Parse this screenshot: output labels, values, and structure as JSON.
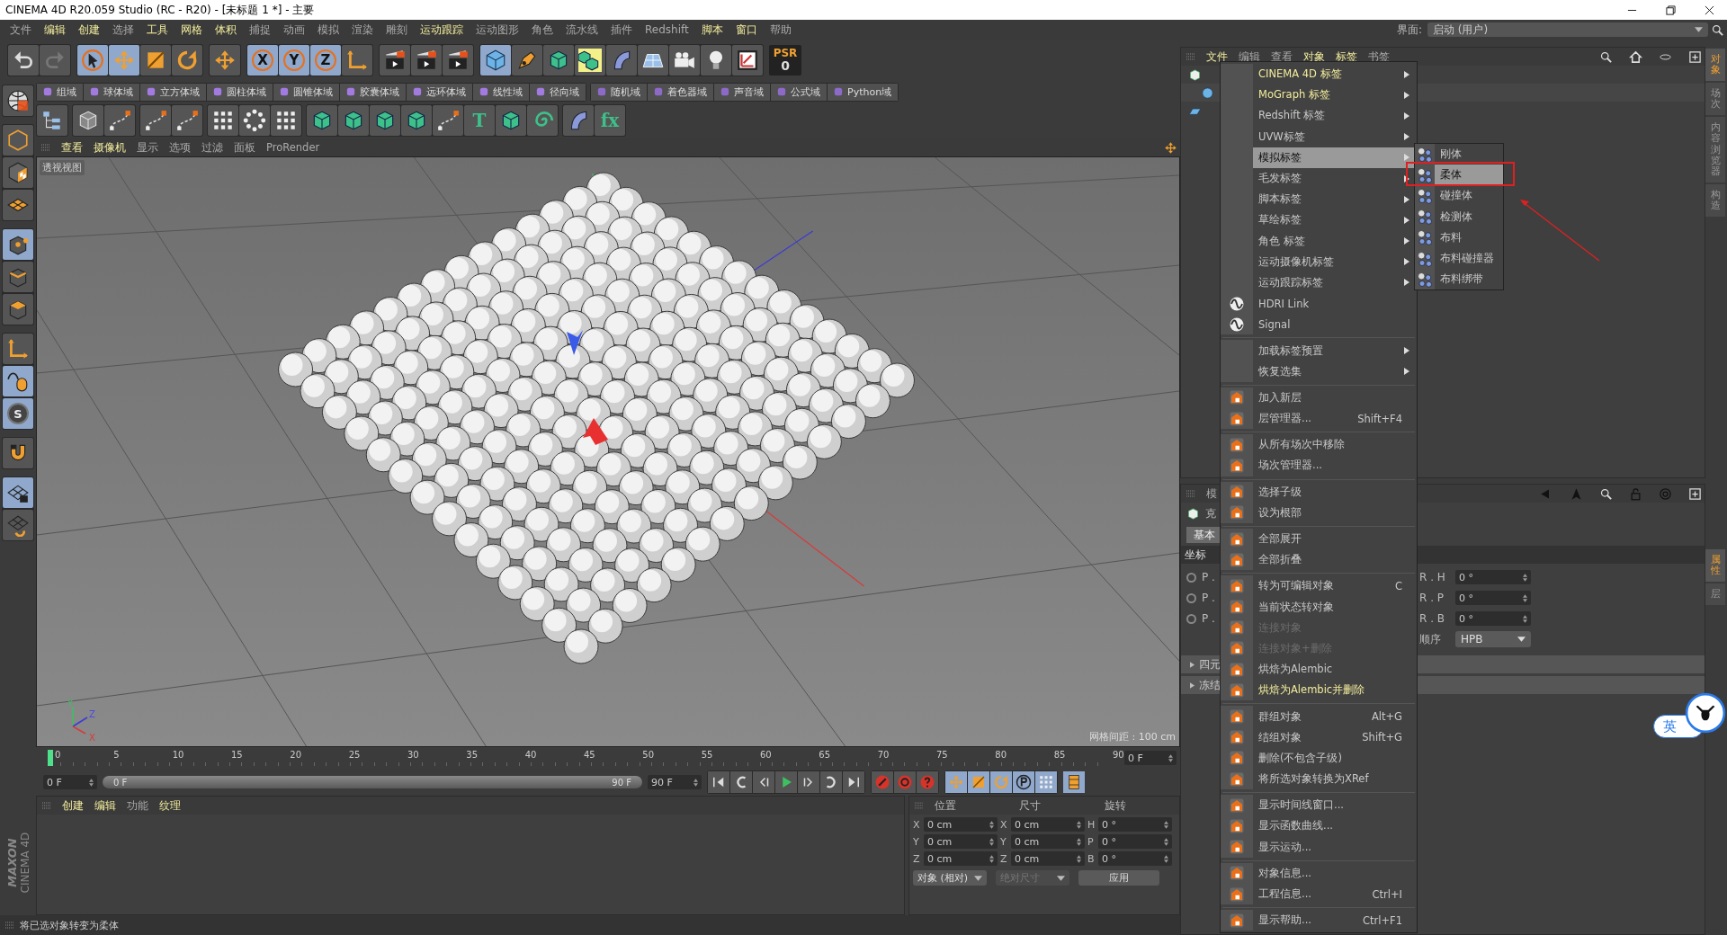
{
  "window": {
    "title": "CINEMA 4D R20.059 Studio (RC - R20) - [未标题 1 *] - 主要"
  },
  "menu_bar": [
    {
      "label": "文件",
      "accent": false
    },
    {
      "label": "编辑",
      "accent": true
    },
    {
      "label": "创建",
      "accent": true
    },
    {
      "label": "选择",
      "accent": false
    },
    {
      "label": "工具",
      "accent": true
    },
    {
      "label": "网格",
      "accent": true
    },
    {
      "label": "体积",
      "accent": true
    },
    {
      "label": "捕捉",
      "accent": false
    },
    {
      "label": "动画",
      "accent": false
    },
    {
      "label": "模拟",
      "accent": false
    },
    {
      "label": "渲染",
      "accent": false
    },
    {
      "label": "雕刻",
      "accent": false
    },
    {
      "label": "运动跟踪",
      "accent": true
    },
    {
      "label": "运动图形",
      "accent": false
    },
    {
      "label": "角色",
      "accent": false
    },
    {
      "label": "流水线",
      "accent": false
    },
    {
      "label": "插件",
      "accent": false
    },
    {
      "label": "Redshift",
      "accent": false
    },
    {
      "label": "脚本",
      "accent": true
    },
    {
      "label": "窗口",
      "accent": true
    },
    {
      "label": "帮助",
      "accent": false
    }
  ],
  "layout_selector": {
    "label": "界面:",
    "value": "启动 (用户)"
  },
  "main_toolbar": [
    [
      {
        "kind": "undo",
        "selected": false
      },
      {
        "kind": "redo",
        "selected": false
      }
    ],
    [
      {
        "kind": "cursor",
        "selected": true
      },
      {
        "kind": "move",
        "selected": true
      },
      {
        "kind": "scale",
        "selected": false
      },
      {
        "kind": "rotate",
        "selected": false
      }
    ],
    [
      {
        "kind": "move",
        "selected": false
      }
    ],
    [
      {
        "kind": "letter",
        "label": "X",
        "selected": true
      },
      {
        "kind": "letter",
        "label": "Y",
        "selected": true
      },
      {
        "kind": "letter",
        "label": "Z",
        "selected": true
      },
      {
        "kind": "axes",
        "selected": false
      }
    ],
    [
      {
        "kind": "clapperboard",
        "selected": false
      },
      {
        "kind": "clapperboard",
        "selected": false
      },
      {
        "kind": "clapperboard",
        "selected": false
      }
    ],
    [
      {
        "kind": "cube",
        "selected": true
      },
      {
        "kind": "pen",
        "selected": false
      },
      {
        "kind": "green-cube",
        "selected": false
      },
      {
        "kind": "cubes",
        "selected": false
      },
      {
        "kind": "bend",
        "selected": false
      },
      {
        "kind": "floor",
        "selected": false
      },
      {
        "kind": "camera",
        "selected": false
      },
      {
        "kind": "bulb",
        "selected": false
      },
      {
        "kind": "graph",
        "selected": false
      }
    ]
  ],
  "psr": {
    "label": "PSR",
    "value": "0"
  },
  "field_toolbar": [
    [
      "组域",
      "球体域",
      "立方体域",
      "圆柱体域",
      "圆锥体域",
      "胶囊体域",
      "远环体域",
      "线性域",
      "径向域"
    ],
    [
      "随机域",
      "着色器域",
      "声音域",
      "公式域",
      "Python域"
    ]
  ],
  "tool_row": [
    [
      {
        "kind": "hierarchy"
      }
    ],
    [
      {
        "kind": "grid-cube"
      },
      {
        "kind": "spline"
      }
    ],
    [
      {
        "kind": "spline"
      },
      {
        "kind": "spline"
      }
    ],
    [
      {
        "kind": "dots"
      },
      {
        "kind": "ring-dots"
      },
      {
        "kind": "dots"
      }
    ],
    [
      {
        "kind": "green-cube"
      },
      {
        "kind": "green-cube"
      },
      {
        "kind": "green-cube"
      },
      {
        "kind": "green-cube"
      },
      {
        "kind": "spline"
      },
      {
        "kind": "letter",
        "label": "T"
      },
      {
        "kind": "green-cube"
      },
      {
        "kind": "spiral"
      }
    ],
    [
      {
        "kind": "bend"
      },
      {
        "kind": "letter",
        "label": "fx"
      }
    ]
  ],
  "left_toolbar": [
    [
      {
        "kind": "globe",
        "selected": false
      }
    ],
    [
      {
        "kind": "cube-outline",
        "selected": false
      },
      {
        "kind": "checker-cube",
        "selected": false
      },
      {
        "kind": "grid",
        "selected": false
      }
    ],
    [
      {
        "kind": "cube-points",
        "selected": true
      },
      {
        "kind": "cube-edge",
        "selected": false
      },
      {
        "kind": "cube-face",
        "selected": false
      }
    ],
    [
      {
        "kind": "axes",
        "selected": false
      },
      {
        "kind": "mouse",
        "selected": true
      },
      {
        "kind": "letter",
        "label": "S",
        "selected": true
      }
    ],
    [
      {
        "kind": "magnet",
        "selected": false
      }
    ],
    [
      {
        "kind": "grid-lock",
        "selected": true
      },
      {
        "kind": "grid-refresh",
        "selected": false
      }
    ]
  ],
  "logo": {
    "brand": "MAXON",
    "product": "CINEMA 4D"
  },
  "viewport": {
    "menu": [
      {
        "label": "查看",
        "accent": true
      },
      {
        "label": "摄像机",
        "accent": true
      },
      {
        "label": "显示",
        "accent": false
      },
      {
        "label": "选项",
        "accent": false
      },
      {
        "label": "过滤",
        "accent": false
      },
      {
        "label": "面板",
        "accent": false
      },
      {
        "label": "ProRender",
        "accent": false
      }
    ],
    "label": "透视视图",
    "grid_spacing": "网格间距 : 100 cm",
    "axis_labels": [
      "Y",
      "Z",
      "X"
    ]
  },
  "timeline": {
    "ticks": [
      "0",
      "5",
      "10",
      "15",
      "20",
      "25",
      "30",
      "35",
      "40",
      "45",
      "50",
      "55",
      "60",
      "65",
      "70",
      "75",
      "80",
      "85",
      "90"
    ],
    "level": 0,
    "current": "0 F",
    "start": "0 F",
    "range": {
      "start": "0 F",
      "end": "90 F",
      "level": 1
    },
    "end": "90 F"
  },
  "material_panel": {
    "menu": [
      {
        "label": "创建",
        "accent": true
      },
      {
        "label": "编辑",
        "accent": true
      },
      {
        "label": "功能",
        "accent": false
      },
      {
        "label": "纹理",
        "accent": true
      }
    ]
  },
  "coord_panel": {
    "headers": [
      "位置",
      "尺寸",
      "旋转"
    ],
    "rows": [
      [
        {
          "axis": "X",
          "value": "0 cm"
        },
        {
          "axis": "X",
          "value": "0 cm"
        },
        {
          "axis": "H",
          "value": "0 °"
        }
      ],
      [
        {
          "axis": "Y",
          "value": "0 cm"
        },
        {
          "axis": "Y",
          "value": "0 cm"
        },
        {
          "axis": "P",
          "value": "0 °"
        }
      ],
      [
        {
          "axis": "Z",
          "value": "0 cm"
        },
        {
          "axis": "Z",
          "value": "0 cm"
        },
        {
          "axis": "B",
          "value": "0 °"
        }
      ]
    ],
    "controls": [
      {
        "kind": "dropdown",
        "label": "对象 (相对)",
        "disabled": false
      },
      {
        "kind": "dropdown",
        "label": "绝对尺寸",
        "disabled": true
      },
      {
        "kind": "button",
        "label": "应用",
        "disabled": false
      }
    ]
  },
  "status_bar": "将已选对象转变为柔体",
  "object_manager": {
    "menu": [
      {
        "label": "文件",
        "accent": true
      },
      {
        "label": "编辑",
        "accent": false
      },
      {
        "label": "查看",
        "accent": false
      },
      {
        "label": "对象",
        "accent": true
      },
      {
        "label": "标签",
        "accent": true
      },
      {
        "label": "书签",
        "accent": false
      }
    ]
  },
  "attributes": {
    "mode": "模",
    "object": "克",
    "tabs": [
      {
        "label": "基本",
        "selected": true
      }
    ],
    "section": "坐标",
    "radio_rows": [
      {
        "label": "P .",
        "checked": false
      },
      {
        "label": "P .",
        "checked": false
      },
      {
        "label": "P .",
        "checked": false
      }
    ],
    "rotation": [
      {
        "label": "R . H",
        "value": "0 °"
      },
      {
        "label": "R . P",
        "value": "0 °"
      },
      {
        "label": "R . B",
        "value": "0 °"
      }
    ],
    "order": {
      "label": "顺序",
      "value": "HPB"
    },
    "groups": [
      "四元",
      "冻结"
    ]
  },
  "side_tabs_top": [
    {
      "label": "对象",
      "selected": true
    },
    {
      "label": "场次",
      "selected": false
    },
    {
      "label": "内容浏览器",
      "selected": false
    },
    {
      "label": "构造",
      "selected": false
    }
  ],
  "side_tabs_bottom": [
    {
      "label": "属性",
      "selected": true
    },
    {
      "label": "层",
      "selected": false
    }
  ],
  "context_menu": {
    "sections": [
      [
        {
          "label": "CINEMA 4D 标签",
          "kind": "plain",
          "submenu": true,
          "selected": false,
          "disabled": false,
          "accent": true
        },
        {
          "label": "MoGraph 标签",
          "kind": "plain",
          "submenu": true,
          "selected": false,
          "disabled": false,
          "accent": true
        },
        {
          "label": "Redshift 标签",
          "kind": "plain",
          "submenu": true,
          "selected": false,
          "disabled": false,
          "accent": false
        },
        {
          "label": "UVW标签",
          "kind": "plain",
          "submenu": true,
          "selected": false,
          "disabled": false,
          "accent": false
        },
        {
          "label": "模拟标签",
          "kind": "plain",
          "submenu": true,
          "selected": true,
          "disabled": false,
          "accent": false
        },
        {
          "label": "毛发标签",
          "kind": "plain",
          "submenu": true,
          "selected": false,
          "disabled": false,
          "accent": false
        },
        {
          "label": "脚本标签",
          "kind": "plain",
          "submenu": true,
          "selected": false,
          "disabled": false,
          "accent": false
        },
        {
          "label": "草绘标签",
          "kind": "plain",
          "submenu": true,
          "selected": false,
          "disabled": false,
          "accent": false
        },
        {
          "label": "角色 标签",
          "kind": "plain",
          "submenu": true,
          "selected": false,
          "disabled": false,
          "accent": false
        },
        {
          "label": "运动摄像机标签",
          "kind": "plain",
          "submenu": true,
          "selected": false,
          "disabled": false,
          "accent": false
        },
        {
          "label": "运动跟踪标签",
          "kind": "plain",
          "submenu": true,
          "selected": false,
          "disabled": false,
          "accent": false
        },
        {
          "label": "HDRI Link",
          "kind": "circle",
          "submenu": false,
          "selected": false,
          "disabled": false,
          "accent": false
        },
        {
          "label": "Signal",
          "kind": "circle",
          "submenu": false,
          "selected": false,
          "disabled": false,
          "accent": false
        }
      ],
      [
        {
          "label": "加载标签预置",
          "kind": "plain",
          "submenu": true,
          "selected": false,
          "disabled": false,
          "accent": false
        },
        {
          "label": "恢复选集",
          "kind": "plain",
          "submenu": true,
          "selected": false,
          "disabled": false,
          "accent": false
        }
      ],
      [
        {
          "label": "加入新层",
          "kind": "icon",
          "submenu": false,
          "selected": false,
          "disabled": false,
          "accent": false
        },
        {
          "label": "层管理器...",
          "shortcut": "Shift+F4",
          "kind": "icon",
          "submenu": false,
          "selected": false,
          "disabled": false,
          "accent": false
        }
      ],
      [
        {
          "label": "从所有场次中移除",
          "kind": "icon",
          "submenu": false,
          "selected": false,
          "disabled": false,
          "accent": false
        },
        {
          "label": "场次管理器...",
          "kind": "icon",
          "submenu": false,
          "selected": false,
          "disabled": false,
          "accent": false
        }
      ],
      [
        {
          "label": "选择子级",
          "kind": "icon",
          "submenu": false,
          "selected": false,
          "disabled": false,
          "accent": false
        },
        {
          "label": "设为根部",
          "kind": "icon",
          "submenu": false,
          "selected": false,
          "disabled": false,
          "accent": false
        }
      ],
      [
        {
          "label": "全部展开",
          "kind": "icon",
          "submenu": false,
          "selected": false,
          "disabled": false,
          "accent": false
        },
        {
          "label": "全部折叠",
          "kind": "icon",
          "submenu": false,
          "selected": false,
          "disabled": false,
          "accent": false
        }
      ],
      [
        {
          "label": "转为可编辑对象",
          "shortcut": "C",
          "kind": "icon",
          "submenu": false,
          "selected": false,
          "disabled": false,
          "accent": false
        },
        {
          "label": "当前状态转对象",
          "kind": "icon",
          "submenu": false,
          "selected": false,
          "disabled": false,
          "accent": false
        },
        {
          "label": "连接对象",
          "kind": "icon",
          "submenu": false,
          "selected": false,
          "disabled": true,
          "accent": false
        },
        {
          "label": "连接对象+删除",
          "kind": "icon",
          "submenu": false,
          "selected": false,
          "disabled": true,
          "accent": false
        },
        {
          "label": "烘焙为Alembic",
          "kind": "icon",
          "submenu": false,
          "selected": false,
          "disabled": false,
          "accent": false
        },
        {
          "label": "烘焙为Alembic并删除",
          "kind": "icon",
          "submenu": false,
          "selected": false,
          "disabled": false,
          "accent": true
        }
      ],
      [
        {
          "label": "群组对象",
          "shortcut": "Alt+G",
          "kind": "icon",
          "submenu": false,
          "selected": false,
          "disabled": false,
          "accent": false
        },
        {
          "label": "结组对象",
          "shortcut": "Shift+G",
          "kind": "icon",
          "submenu": false,
          "selected": false,
          "disabled": false,
          "accent": false
        },
        {
          "label": "删除(不包含子级)",
          "kind": "icon",
          "submenu": false,
          "selected": false,
          "disabled": false,
          "accent": false
        },
        {
          "label": "将所选对象转换为XRef",
          "kind": "icon",
          "submenu": false,
          "selected": false,
          "disabled": false,
          "accent": false
        }
      ],
      [
        {
          "label": "显示时间线窗口...",
          "kind": "icon",
          "submenu": false,
          "selected": false,
          "disabled": false,
          "accent": false
        },
        {
          "label": "显示函数曲线...",
          "kind": "icon",
          "submenu": false,
          "selected": false,
          "disabled": false,
          "accent": false
        },
        {
          "label": "显示运动...",
          "kind": "icon",
          "submenu": false,
          "selected": false,
          "disabled": false,
          "accent": false
        }
      ],
      [
        {
          "label": "对象信息...",
          "kind": "icon",
          "submenu": false,
          "selected": false,
          "disabled": false,
          "accent": false
        },
        {
          "label": "工程信息...",
          "shortcut": "Ctrl+I",
          "kind": "icon",
          "submenu": false,
          "selected": false,
          "disabled": false,
          "accent": false
        }
      ],
      [
        {
          "label": "显示帮助...",
          "shortcut": "Ctrl+F1",
          "kind": "icon",
          "submenu": false,
          "selected": false,
          "disabled": false,
          "accent": false
        }
      ]
    ]
  },
  "submenu": [
    {
      "label": "刚体",
      "selected": false
    },
    {
      "label": "柔体",
      "selected": true
    },
    {
      "label": "碰撞体",
      "selected": false
    },
    {
      "label": "检测体",
      "selected": false
    },
    {
      "label": "布料",
      "selected": false
    },
    {
      "label": "布料碰撞器",
      "selected": false
    },
    {
      "label": "布料绑带",
      "selected": false
    }
  ],
  "ime_badge": {
    "label": "英"
  }
}
